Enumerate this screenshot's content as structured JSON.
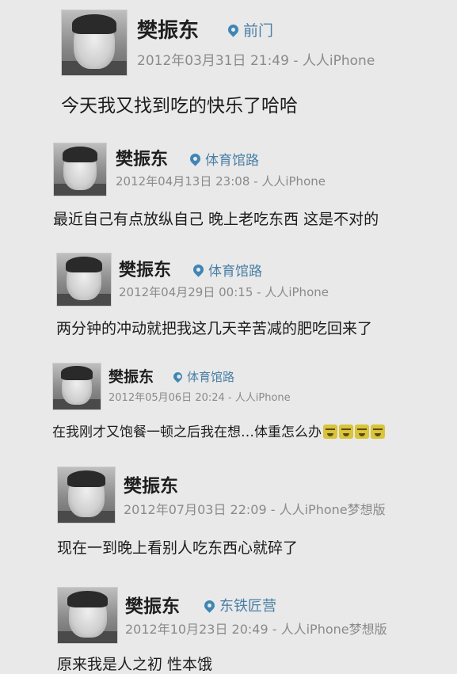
{
  "posts": [
    {
      "name": "樊振东",
      "location": "前门",
      "date": "2012年03月31日",
      "time": "21:49",
      "source": "人人iPhone",
      "content": "今天我又找到吃的快乐了哈哈"
    },
    {
      "name": "樊振东",
      "location": "体育馆路",
      "date": "2012年04月13日",
      "time": "23:08",
      "source": "人人iPhone",
      "content": "最近自己有点放纵自己 晚上老吃东西 这是不对的"
    },
    {
      "name": "樊振东",
      "location": "体育馆路",
      "date": "2012年04月29日",
      "time": "00:15",
      "source": "人人iPhone",
      "content": "两分钟的冲动就把我这几天辛苦减的肥吃回来了"
    },
    {
      "name": "樊振东",
      "location": "体育馆路",
      "date": "2012年05月06日",
      "time": "20:24",
      "source": "人人iPhone",
      "content": "在我刚才又饱餐一顿之后我在想…体重怎么办",
      "emoji_count": 4,
      "emoji_icon": "crying-laughing-emoji-icon"
    },
    {
      "name": "樊振东",
      "location": "",
      "date": "2012年07月03日",
      "time": "22:09",
      "source": "人人iPhone梦想版",
      "content": "现在一到晚上看别人吃东西心就碎了"
    },
    {
      "name": "樊振东",
      "location": "东铁匠营",
      "date": "2012年10月23日",
      "time": "20:49",
      "source": "人人iPhone梦想版",
      "content": "原来我是人之初 性本饿"
    }
  ],
  "icons": {
    "location": "location-pin-icon",
    "avatar": "avatar"
  },
  "colors": {
    "location": "#4a7fa6",
    "meta": "#8a8a8a",
    "background": "#e9e9e9"
  }
}
